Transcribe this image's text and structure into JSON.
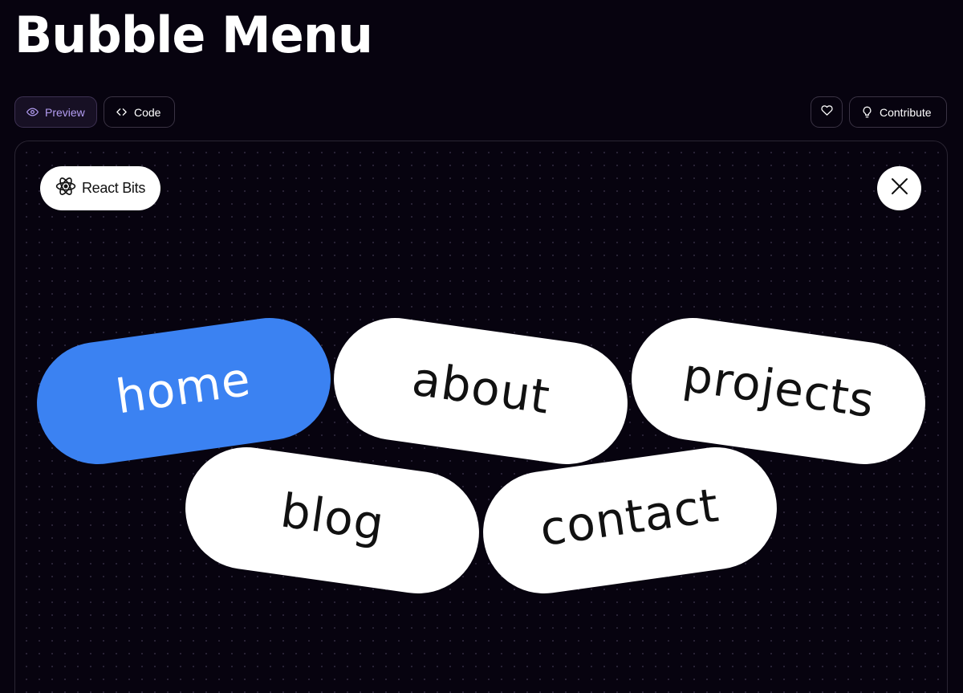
{
  "header": {
    "title": "Bubble Menu"
  },
  "toolbar": {
    "tabs": [
      {
        "label": "Preview",
        "icon": "eye-icon",
        "active": true
      },
      {
        "label": "Code",
        "icon": "code-brackets-icon",
        "active": false
      }
    ],
    "favorite_icon": "heart-icon",
    "contribute_label": "Contribute",
    "contribute_icon": "lightbulb-icon"
  },
  "preview": {
    "logo": {
      "text": "React Bits",
      "icon": "atom-icon"
    },
    "close_icon": "close-icon",
    "menu_items": [
      {
        "label": "home",
        "active": true
      },
      {
        "label": "about",
        "active": false
      },
      {
        "label": "projects",
        "active": false
      },
      {
        "label": "blog",
        "active": false
      },
      {
        "label": "contact",
        "active": false
      }
    ]
  },
  "colors": {
    "background": "#07030f",
    "accent_active_tab": "#b39df2",
    "bubble_active": "#3b82f2",
    "bubble_default": "#ffffff",
    "bubble_text": "#111111"
  }
}
